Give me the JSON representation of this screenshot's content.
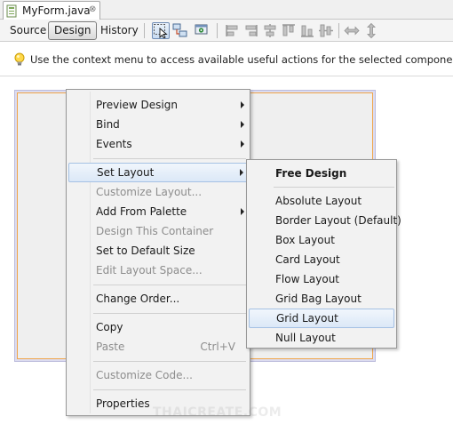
{
  "file_tab": {
    "name": "MyForm.java",
    "close": "⊗"
  },
  "view_tabs": [
    {
      "label": "Source"
    },
    {
      "label": "Design"
    },
    {
      "label": "History"
    }
  ],
  "toolbar_icons": [
    "selection-mode-icon",
    "connection-mode-icon",
    "preview-design-icon",
    "align-left-icon",
    "align-right-icon",
    "center-horizontally-icon",
    "align-top-icon",
    "align-bottom-icon",
    "center-vertically-icon",
    "change-horizontal-resizability-icon",
    "change-vertical-resizability-icon"
  ],
  "hint": {
    "text": "Use the context menu to access available useful actions for the selected components."
  },
  "context_menu": {
    "items": [
      {
        "label": "Preview Design",
        "submenu": true
      },
      {
        "label": "Bind",
        "submenu": true
      },
      {
        "label": "Events",
        "submenu": true
      },
      {
        "label": "Set Layout",
        "submenu": true,
        "highlighted": true
      },
      {
        "label": "Customize Layout...",
        "disabled": true
      },
      {
        "label": "Add From Palette",
        "submenu": true
      },
      {
        "label": "Design This Container",
        "disabled": true
      },
      {
        "label": "Set to Default Size"
      },
      {
        "label": "Edit Layout Space...",
        "disabled": true
      },
      {
        "label": "Change Order..."
      },
      {
        "label": "Copy"
      },
      {
        "label": "Paste",
        "shortcut": "Ctrl+V",
        "disabled": true
      },
      {
        "label": "Customize Code...",
        "disabled": true
      },
      {
        "label": "Properties"
      }
    ]
  },
  "layout_submenu": {
    "items": [
      {
        "label": "Free Design",
        "bold": true
      },
      {
        "label": "Absolute Layout"
      },
      {
        "label": "Border Layout (Default)"
      },
      {
        "label": "Box Layout"
      },
      {
        "label": "Card Layout"
      },
      {
        "label": "Flow Layout"
      },
      {
        "label": "Grid Bag Layout"
      },
      {
        "label": "Grid Layout",
        "highlighted": true
      },
      {
        "label": "Null Layout"
      }
    ]
  },
  "colors": {
    "selection_border": "#f0a54a",
    "menu_highlight": "#dbe8f7",
    "disabled_text": "#8d8d8d"
  },
  "watermark": "THAICREATE.COM"
}
